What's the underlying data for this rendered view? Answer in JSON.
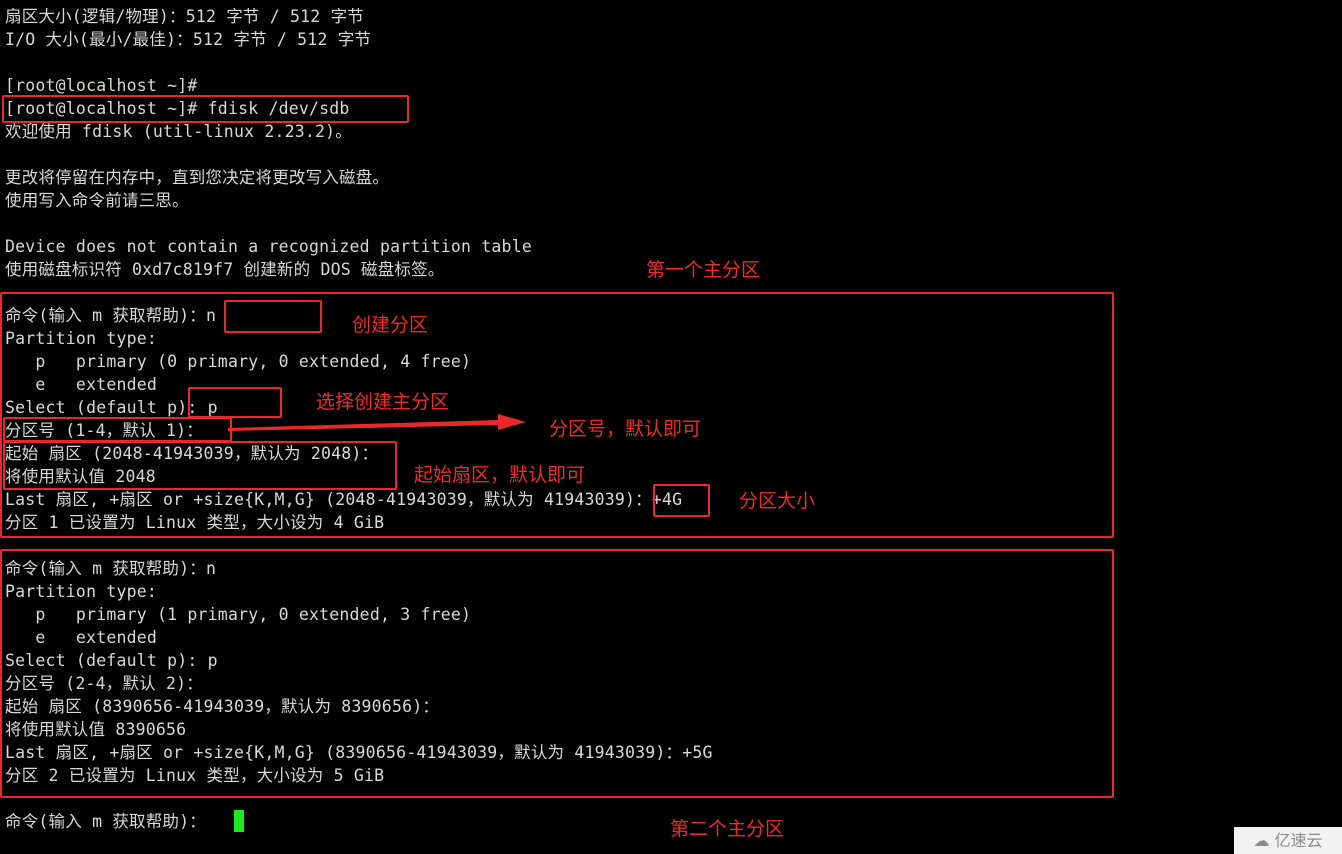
{
  "terminal": {
    "lines": [
      "扇区大小(逻辑/物理)：512 字节 / 512 字节",
      "I/O 大小(最小/最佳)：512 字节 / 512 字节",
      "",
      "[root@localhost ~]#",
      "[root@localhost ~]# fdisk /dev/sdb",
      "欢迎使用 fdisk (util-linux 2.23.2)。",
      "",
      "更改将停留在内存中，直到您决定将更改写入磁盘。",
      "使用写入命令前请三思。",
      "",
      "Device does not contain a recognized partition table",
      "使用磁盘标识符 0xd7c819f7 创建新的 DOS 磁盘标签。",
      "",
      "命令(输入 m 获取帮助)：n",
      "Partition type:",
      "   p   primary (0 primary, 0 extended, 4 free)",
      "   e   extended",
      "Select (default p): p",
      "分区号 (1-4，默认 1)：",
      "起始 扇区 (2048-41943039，默认为 2048)：",
      "将使用默认值 2048",
      "Last 扇区, +扇区 or +size{K,M,G} (2048-41943039，默认为 41943039)：+4G",
      "分区 1 已设置为 Linux 类型，大小设为 4 GiB",
      "",
      "命令(输入 m 获取帮助)：n",
      "Partition type:",
      "   p   primary (1 primary, 0 extended, 3 free)",
      "   e   extended",
      "Select (default p): p",
      "分区号 (2-4，默认 2)：",
      "起始 扇区 (8390656-41943039，默认为 8390656)：",
      "将使用默认值 8390656",
      "Last 扇区, +扇区 or +size{K,M,G} (8390656-41943039，默认为 41943039)：+5G",
      "分区 2 已设置为 Linux 类型，大小设为 5 GiB",
      "",
      "命令(输入 m 获取帮助)："
    ]
  },
  "annotations": {
    "first_primary": "第一个主分区",
    "create_partition": "创建分区",
    "select_primary": "选择创建主分区",
    "partition_number": "分区号，默认即可",
    "start_sector": "起始扇区，默认即可",
    "partition_size": "分区大小",
    "second_primary": "第二个主分区"
  },
  "watermark": {
    "icon": "cloud-logo-icon",
    "text": "亿速云"
  },
  "colors": {
    "annotation": "#ee2a2a",
    "cursor": "#1ee81e",
    "text": "#d8d8d8"
  }
}
